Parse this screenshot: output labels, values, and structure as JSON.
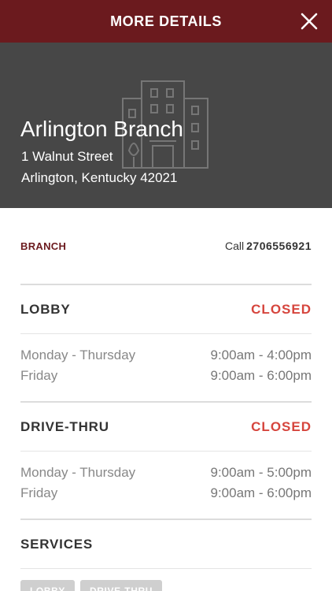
{
  "header": {
    "title": "MORE DETAILS"
  },
  "branch": {
    "name": "Arlington Branch",
    "address_line1": "1 Walnut Street",
    "address_line2": "Arlington, Kentucky 42021",
    "type_label": "BRANCH",
    "call_label": "Call",
    "phone": "2706556921"
  },
  "lobby": {
    "title": "LOBBY",
    "status": "CLOSED",
    "hours": [
      {
        "days": "Monday - Thursday",
        "time": "9:00am - 4:00pm"
      },
      {
        "days": "Friday",
        "time": "9:00am - 6:00pm"
      }
    ]
  },
  "drive_thru": {
    "title": "DRIVE-THRU",
    "status": "CLOSED",
    "hours": [
      {
        "days": "Monday - Thursday",
        "time": "9:00am - 5:00pm"
      },
      {
        "days": "Friday",
        "time": "9:00am - 6:00pm"
      }
    ]
  },
  "services": {
    "title": "SERVICES",
    "chips": [
      "LOBBY",
      "DRIVE-THRU"
    ]
  },
  "colors": {
    "header_bg": "#6b1a1e",
    "hero_bg": "#474747",
    "status_closed": "#d6453d"
  },
  "icons": {
    "close": "close-icon",
    "hero": "building-icon"
  }
}
